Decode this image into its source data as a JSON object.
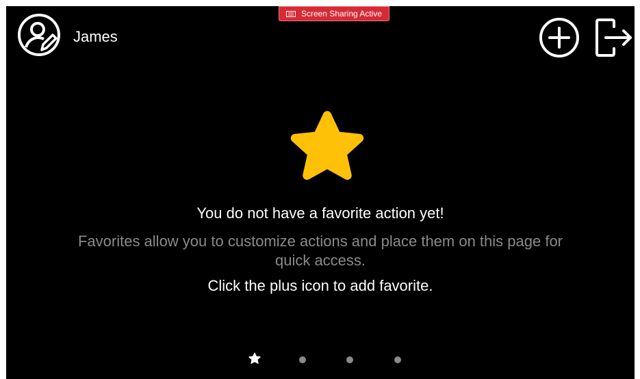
{
  "status_bar": {
    "sharing_label": "Screen Sharing Active",
    "sharing_icon": "screen-share-icon",
    "sharing_color": "#d72a35"
  },
  "user": {
    "name": "James",
    "avatar_icon": "user-edit-icon"
  },
  "header_actions": [
    {
      "name": "add-favorite",
      "icon": "plus-circle-icon"
    },
    {
      "name": "logout",
      "icon": "logout-icon"
    }
  ],
  "empty_state": {
    "icon": "star-icon",
    "icon_color": "#ffc107",
    "title": "You do not have a favorite action yet!",
    "description": "Favorites allow you to customize actions and place them on this page for quick access.",
    "hint": "Click the plus icon to add favorite."
  },
  "pager": {
    "page_count": 4,
    "active_page": 1,
    "first_item_icon": "star-icon"
  }
}
